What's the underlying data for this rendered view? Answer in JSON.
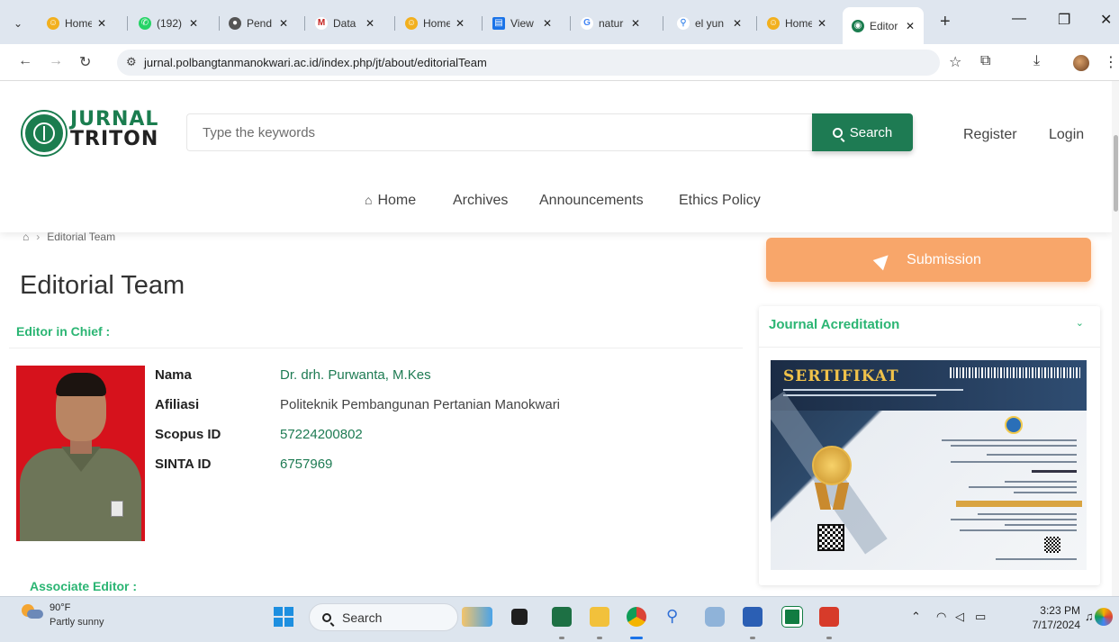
{
  "browser": {
    "tabs": [
      {
        "label": "Home",
        "icon": "smiley-icon",
        "color": "#f2b01e"
      },
      {
        "label": "(192)",
        "icon": "whatsapp-icon",
        "color": "#25d366"
      },
      {
        "label": "Pend",
        "icon": "globe-icon",
        "color": "#555555"
      },
      {
        "label": "Data",
        "icon": "gmail-icon",
        "color": "#c5221f"
      },
      {
        "label": "Home",
        "icon": "smiley-icon",
        "color": "#f2b01e"
      },
      {
        "label": "View",
        "icon": "document-icon",
        "color": "#1a73e8"
      },
      {
        "label": "natur",
        "icon": "google-icon",
        "color": "#4285f4"
      },
      {
        "label": "el yun",
        "icon": "search-icon",
        "color": "#1a73e8"
      },
      {
        "label": "Home",
        "icon": "smiley-icon",
        "color": "#f2b01e"
      },
      {
        "label": "Editor",
        "icon": "site-icon",
        "color": "#1b7d4f"
      }
    ],
    "url": "jurnal.polbangtanmanokwari.ac.id/index.php/jt/about/editorialTeam"
  },
  "site": {
    "logo_line1": "JURNAL",
    "logo_line2": "TRITON",
    "search_placeholder": "Type the keywords",
    "search_button": "Search",
    "register": "Register",
    "login": "Login",
    "nav": [
      "Home",
      "Archives",
      "Announcements",
      "Ethics Policy"
    ]
  },
  "breadcrumb": {
    "current": "Editorial Team"
  },
  "page": {
    "title": "Editorial Team",
    "section_chief": "Editor in Chief :",
    "section_associate": "Associate Editor :",
    "editor": {
      "labels": [
        "Nama",
        "Afiliasi",
        "Scopus ID",
        "SINTA ID"
      ],
      "name": "Dr. drh. Purwanta, M.Kes",
      "affiliation": "Politeknik Pembangunan Pertanian Manokwari",
      "scopus": "57224200802",
      "sinta": "6757969"
    }
  },
  "sidebar": {
    "submission": "Submission",
    "accreditation_title": "Journal Acreditation",
    "certificate_title": "SERTIFIKAT"
  },
  "taskbar": {
    "temperature": "90°F",
    "weather": "Partly sunny",
    "search": "Search",
    "time": "3:23 PM",
    "date": "7/17/2024"
  },
  "colors": {
    "brand_green": "#1e7b53",
    "accent_green": "#2bb573",
    "submission_orange": "#f8a66a"
  }
}
